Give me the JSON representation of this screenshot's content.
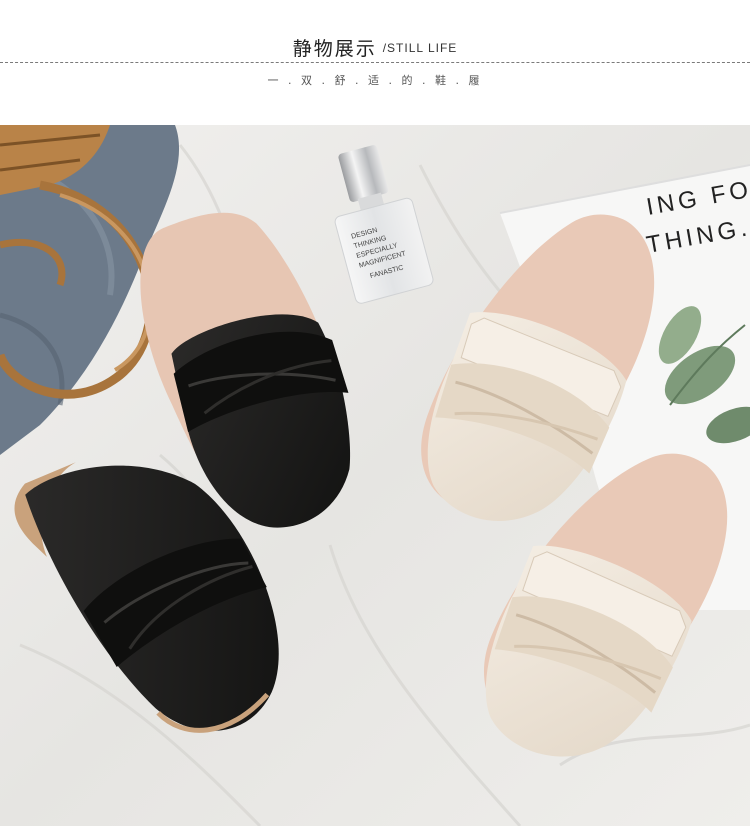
{
  "header": {
    "title_cn": "静物展示",
    "title_en": "/STILL LIFE",
    "subtitle": "一 . 双 . 舒 . 适 . 的 . 鞋 . 履"
  },
  "photo": {
    "perfume_label": {
      "line1": "DESIGN",
      "line2": "THINKING",
      "line3": "ESPECIALLY",
      "line4": "MAGNIFICENT",
      "line5": "FANASTIC"
    },
    "book_text": {
      "line1": "ING FOR",
      "line2": "THING."
    },
    "colors": {
      "fabric": "#ecebe8",
      "black_leather": "#1e1d1c",
      "cream_leather": "#efe6da",
      "insole": "#e9c9b7",
      "wicker": "#a8743c",
      "denim": "#6c7a8a",
      "leaf": "#7f9b7b"
    }
  }
}
